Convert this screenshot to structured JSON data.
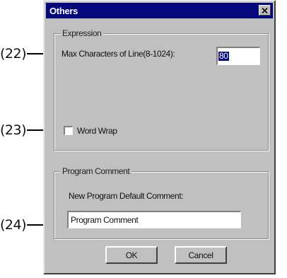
{
  "callouts": [
    {
      "label": "(22)"
    },
    {
      "label": "(23)"
    },
    {
      "label": "(24)"
    }
  ],
  "dialog": {
    "title": "Others",
    "close_icon": "close-x-icon",
    "expression": {
      "legend": "Expression",
      "max_chars_label": "Max Characters of Line(8-1024):",
      "max_chars_value": "80",
      "word_wrap_label": "Word Wrap",
      "word_wrap_checked": false
    },
    "program_comment": {
      "legend": "Program Comment",
      "default_label": "New Program Default Comment:",
      "default_value": "Program Comment"
    },
    "ok_label": "OK",
    "cancel_label": "Cancel"
  },
  "colors": {
    "titlebar": "#05087a",
    "face": "#c0c0c0",
    "selection": "#05087a"
  }
}
